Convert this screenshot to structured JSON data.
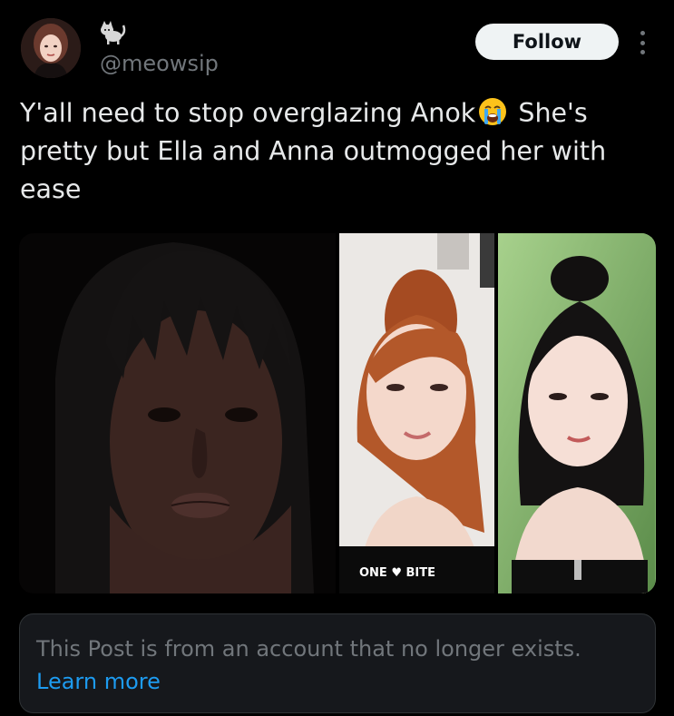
{
  "author": {
    "handle": "@meowsip",
    "name_icon": "black-cat-emoji",
    "avatar_icon": "user-avatar-photo"
  },
  "header": {
    "follow_label": "Follow",
    "more_icon": "more-vertical-icon"
  },
  "post": {
    "text_before_emoji": "Y'all need to stop overglazing Anok",
    "emoji": "loudly-crying-face-emoji",
    "text_after_emoji": " She's pretty but Ella and Anna outmogged her with ease"
  },
  "media": {
    "images": [
      "photo-portrait-woman-dark-hair-bangs",
      "photo-portrait-woman-red-hair",
      "photo-portrait-woman-black-hair"
    ],
    "overlay_text": "ONE ♥ BITE"
  },
  "notice": {
    "text": "This Post is from an account that no longer exists.",
    "link_label": "Learn more"
  },
  "colors": {
    "background": "#000000",
    "text_primary": "#e7e9ea",
    "text_secondary": "#71767b",
    "link": "#1d9bf0",
    "follow_bg": "#eff3f4",
    "notice_bg": "#16181c",
    "border": "#2f3336"
  }
}
